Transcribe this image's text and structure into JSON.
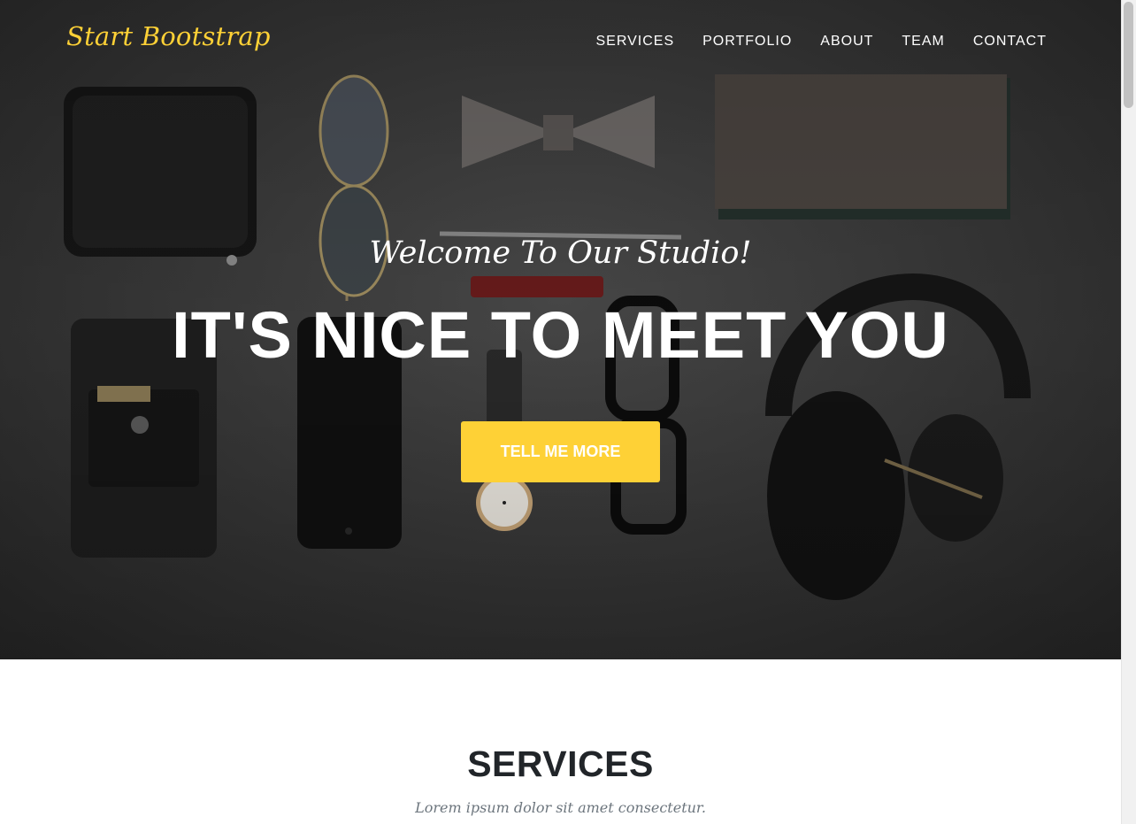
{
  "navbar": {
    "brand": "Start Bootstrap",
    "links": [
      "Services",
      "Portfolio",
      "About",
      "Team",
      "Contact"
    ]
  },
  "hero": {
    "subtitle": "Welcome To Our Studio!",
    "title": "It's Nice To Meet You",
    "button_label": "Tell Me More"
  },
  "services": {
    "heading": "Services",
    "subheading": "Lorem ipsum dolor sit amet consectetur."
  },
  "colors": {
    "accent": "#fed136",
    "heading_text": "#212529",
    "muted_text": "#6c757d",
    "hero_background": "#3a3a3a"
  }
}
